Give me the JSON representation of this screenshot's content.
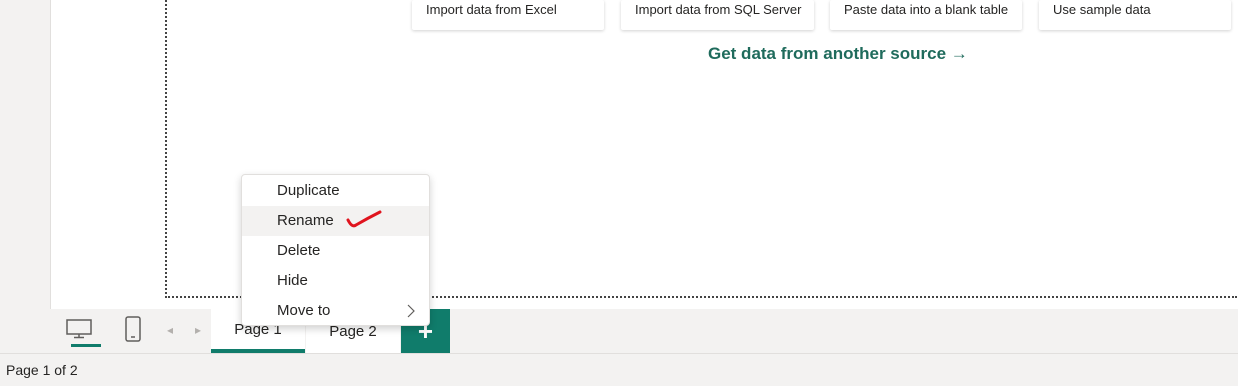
{
  "get_data": {
    "cards": [
      {
        "label": "Import data from Excel"
      },
      {
        "label": "Import data from SQL Server"
      },
      {
        "label": "Paste data into a blank table"
      },
      {
        "label": "Use sample data"
      }
    ],
    "more_link": "Get data from another source →"
  },
  "context_menu": {
    "items": [
      {
        "label": "Duplicate"
      },
      {
        "label": "Rename"
      },
      {
        "label": "Delete"
      },
      {
        "label": "Hide"
      },
      {
        "label": "Move to"
      }
    ],
    "submenu_arrow": ">"
  },
  "tab_bar": {
    "views": [
      {
        "icon": "desktop-view-icon",
        "active": true
      },
      {
        "icon": "mobile-view-icon",
        "active": false
      }
    ],
    "prev_arrow": "◂",
    "next_arrow": "▸",
    "pages": [
      {
        "label": "Page 1",
        "active": true
      },
      {
        "label": "Page 2",
        "active": false
      }
    ],
    "add_label": "+"
  },
  "status_bar": {
    "page_indicator": "Page 1 of 2"
  },
  "colors": {
    "accent": "#107c6b",
    "link": "#1f6b5c",
    "annotation": "#e0141e"
  }
}
